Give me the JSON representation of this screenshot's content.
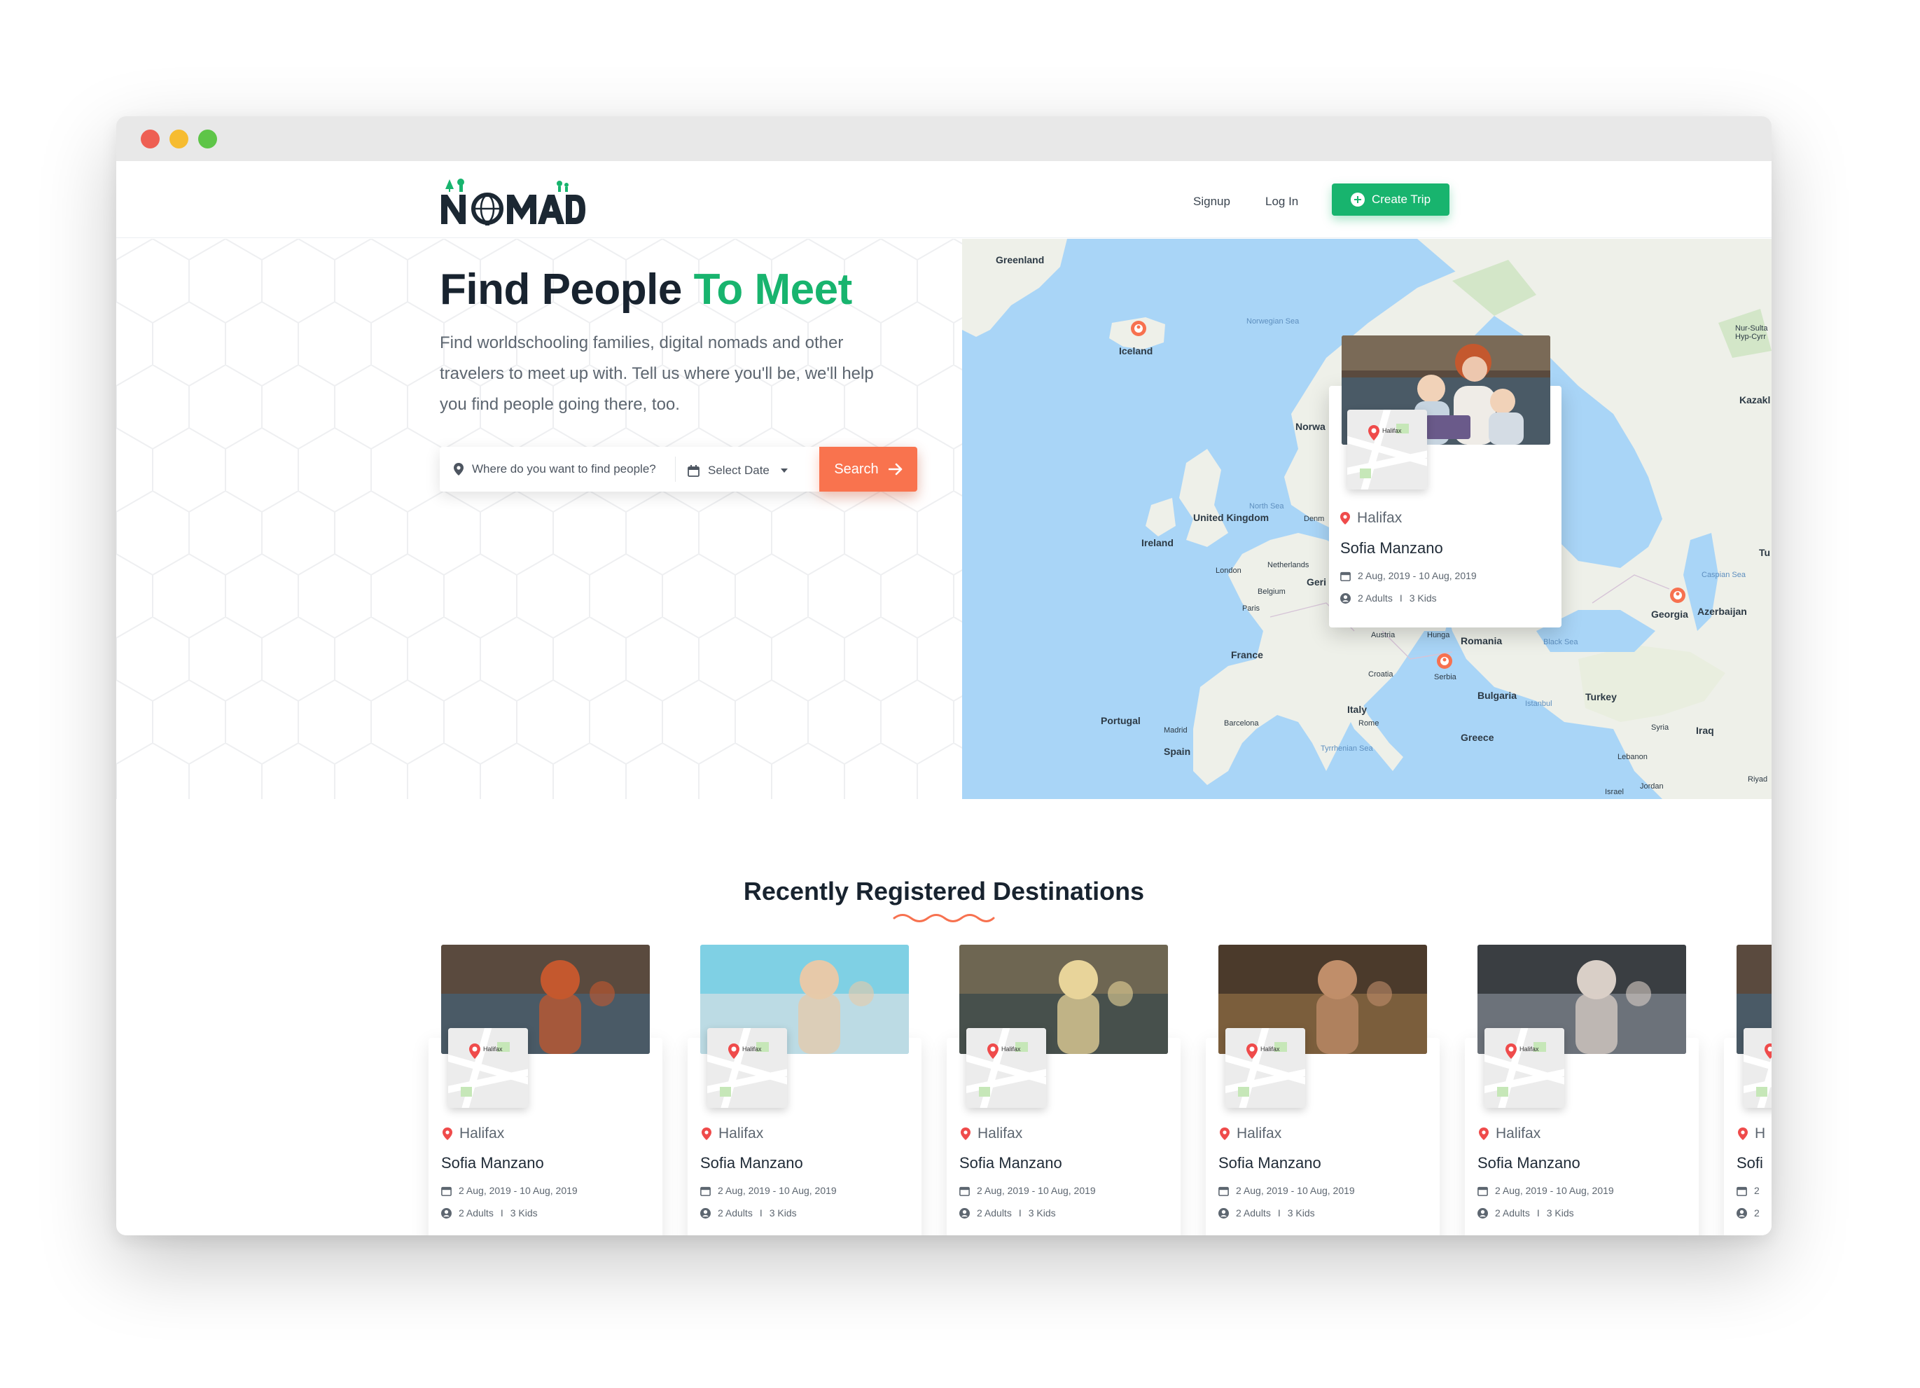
{
  "nav": {
    "logo_text": "NOMAD",
    "signup_label": "Signup",
    "login_label": "Log In",
    "create_trip_label": "Create Trip"
  },
  "hero": {
    "title_main": "Find People",
    "title_accent": "To Meet",
    "description": "Find worldschooling families, digital nomads and other travelers to meet up with. Tell us where you'll be, we'll help you find people going there, too.",
    "search_placeholder": "Where do you want to find people?",
    "date_label": "Select Date",
    "search_button": "Search"
  },
  "map": {
    "labels": {
      "greenland": "Greenland",
      "iceland": "Iceland",
      "norwegian_sea": "Norwegian Sea",
      "norway": "Norwa",
      "uk": "United Kingdom",
      "ireland": "Ireland",
      "north_sea": "North Sea",
      "denmark": "Denm",
      "london": "London",
      "netherlands": "Netherlands",
      "belgium": "Belgium",
      "paris": "Paris",
      "germany": "Geri",
      "france": "France",
      "austria": "Austria",
      "hungary": "Hunga",
      "romania": "Romania",
      "croatia": "Croatia",
      "serbia": "Serbia",
      "bulgaria": "Bulgaria",
      "istanbul": "Istanbul",
      "italy": "Italy",
      "rome": "Rome",
      "portugal": "Portugal",
      "madrid": "Madrid",
      "spain": "Spain",
      "barcelona": "Barcelona",
      "tyrrhenian_sea": "Tyrrhenian Sea",
      "greece": "Greece",
      "turkey": "Turkey",
      "black_sea": "Black Sea",
      "caspian_sea": "Caspian Sea",
      "georgia": "Georgia",
      "azerbaijan": "Azerbaijan",
      "syria": "Syria",
      "iraq": "Iraq",
      "lebanon": "Lebanon",
      "israel": "Israel",
      "jordan": "Jordan",
      "kazakh": "Kazakl",
      "nur_sultan": "Nur-Sulta",
      "hyp_cyrr": "Hyp-Cyrr",
      "tu": "Tu",
      "riyad": "Riyad"
    },
    "card": {
      "city": "Halifax",
      "name": "Sofia Manzano",
      "dates": "2 Aug, 2019 - 10 Aug, 2019",
      "adults": "2 Adults",
      "kids": "3 Kids",
      "thumb_label": "Halifax"
    }
  },
  "destinations": {
    "title": "Recently Registered Destinations",
    "cards": [
      {
        "city": "Halifax",
        "name": "Sofia Manzano",
        "dates": "2 Aug, 2019 - 10 Aug, 2019",
        "adults": "2 Adults",
        "kids": "3 Kids",
        "thumb_label": "Halifax"
      },
      {
        "city": "Halifax",
        "name": "Sofia Manzano",
        "dates": "2 Aug, 2019 - 10 Aug, 2019",
        "adults": "2 Adults",
        "kids": "3 Kids",
        "thumb_label": "Halifax"
      },
      {
        "city": "Halifax",
        "name": "Sofia Manzano",
        "dates": "2 Aug, 2019 - 10 Aug, 2019",
        "adults": "2 Adults",
        "kids": "3 Kids",
        "thumb_label": "Halifax"
      },
      {
        "city": "Halifax",
        "name": "Sofia Manzano",
        "dates": "2 Aug, 2019 - 10 Aug, 2019",
        "adults": "2 Adults",
        "kids": "3 Kids",
        "thumb_label": "Halifax"
      },
      {
        "city": "Halifax",
        "name": "Sofia Manzano",
        "dates": "2 Aug, 2019 - 10 Aug, 2019",
        "adults": "2 Adults",
        "kids": "3 Kids",
        "thumb_label": "Halifax"
      },
      {
        "city": "H",
        "name": "Sofi",
        "dates": "2",
        "adults": "2",
        "kids": "",
        "thumb_label": ""
      }
    ]
  },
  "colors": {
    "brand_green": "#18b46e",
    "accent_orange": "#f9734e",
    "heading": "#18232f",
    "text_muted": "#5d6670",
    "pin_red": "#ef4b4b"
  },
  "icons": {
    "pin": "location-pin-icon",
    "calendar": "calendar-icon",
    "user": "user-icon",
    "arrow": "arrow-right-icon",
    "plus": "plus-circle-icon"
  }
}
